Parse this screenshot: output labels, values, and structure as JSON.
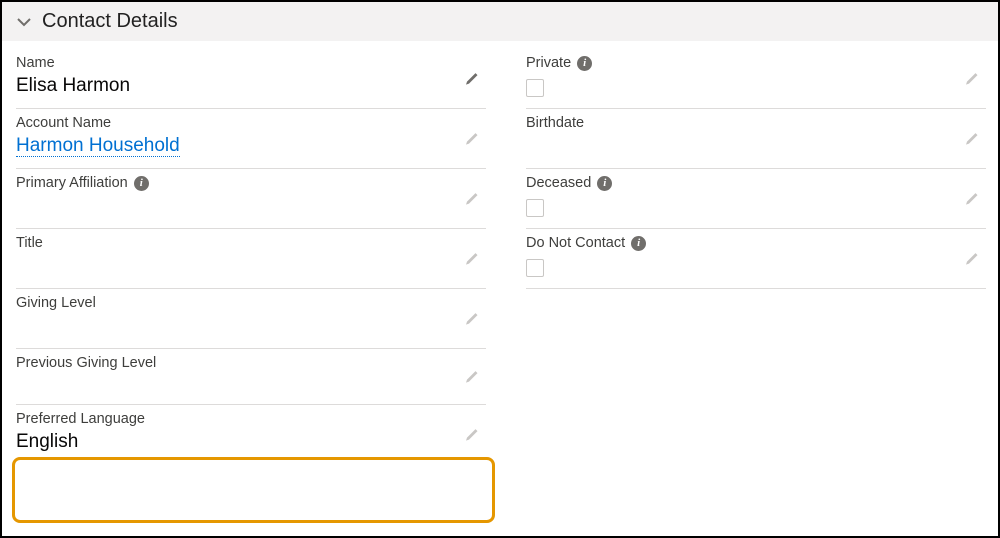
{
  "section": {
    "title": "Contact Details"
  },
  "left": {
    "name": {
      "label": "Name",
      "value": "Elisa Harmon"
    },
    "account": {
      "label": "Account Name",
      "value": "Harmon Household"
    },
    "primary": {
      "label": "Primary Affiliation",
      "value": ""
    },
    "title": {
      "label": "Title",
      "value": ""
    },
    "giving": {
      "label": "Giving Level",
      "value": ""
    },
    "prev": {
      "label": "Previous Giving Level",
      "value": ""
    },
    "lang": {
      "label": "Preferred Language",
      "value": "English"
    }
  },
  "right": {
    "private": {
      "label": "Private"
    },
    "birthdate": {
      "label": "Birthdate",
      "value": ""
    },
    "deceased": {
      "label": "Deceased"
    },
    "dnc": {
      "label": "Do Not Contact"
    }
  }
}
